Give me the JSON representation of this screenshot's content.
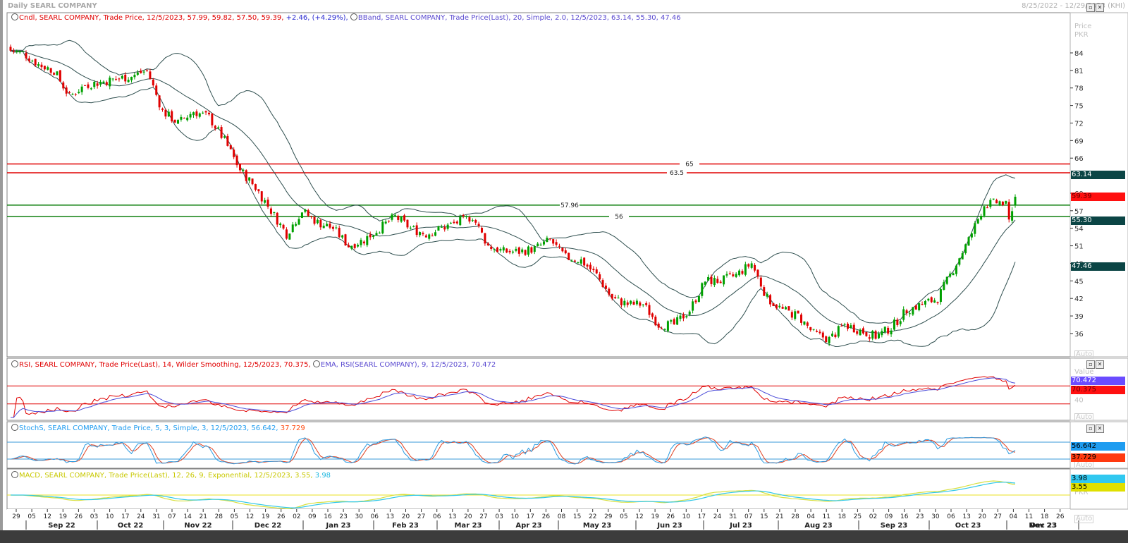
{
  "window": {
    "title": "Daily SEARL COMPANY",
    "date_range": "8/25/2022 - 12/29/2023 (KHI)"
  },
  "legends": {
    "candle": {
      "text": "Cndl, SEARL COMPANY, Trade Price,  12/5/2023, 57.99, 59.82, 57.50, 59.39, ",
      "change": "+2.46, (+4.29%), "
    },
    "bband": "BBand, SEARL COMPANY, Trade Price(Last),  20, Simple, 2.0, 12/5/2023, 63.14, 55.30, 47.46",
    "rsi": "RSI, SEARL COMPANY, Trade Price(Last),  14, Wilder Smoothing, 12/5/2023, 70.375, ",
    "ema": "EMA, RSI(SEARL COMPANY),  9,  12/5/2023, 70.472",
    "stoch": {
      "text": "StochS, SEARL COMPANY, Trade Price,  5, 3, Simple, 3, 12/5/2023, 56.642, ",
      "d": "37.729"
    },
    "macd": {
      "text": "MACD, SEARL COMPANY, Trade Price(Last),  12, 26, 9, Exponential, 12/5/2023, 3.55, ",
      "signal": "3.98"
    }
  },
  "axis_labels": {
    "price": "Price",
    "currency": "PKR",
    "value": "Value",
    "auto": "Auto"
  },
  "badges": {
    "bb_upper": {
      "text": "63.14",
      "value": 63.14,
      "color": "#0b4545"
    },
    "last": {
      "text": "59.39",
      "value": 59.39,
      "color": "#ff1010"
    },
    "bb_mid": {
      "text": "55.30",
      "value": 55.3,
      "color": "#0b4545"
    },
    "bb_lower": {
      "text": "47.46",
      "value": 47.46,
      "color": "#0b4545"
    },
    "ema": {
      "text": "70.472",
      "value": 70.472,
      "color": "#6a4cff"
    },
    "rsi": {
      "text": "70.375",
      "value": 70.375,
      "color": "#ff1010"
    },
    "stoch_k": {
      "text": "56.642",
      "value": 56.642,
      "color": "#1e9cf0"
    },
    "stoch_d": {
      "text": "37.729",
      "value": 37.729,
      "color": "#ff3a10"
    },
    "signal": {
      "text": "3.98",
      "value": 3.98,
      "color": "#30c8f0"
    },
    "macd": {
      "text": "3.55",
      "value": 3.55,
      "color": "#e0e000"
    }
  },
  "chart_data": {
    "type": "candlestick",
    "title": "Daily SEARL COMPANY",
    "ylabel": "Price PKR",
    "ylim": [
      33,
      87
    ],
    "yticks": [
      84,
      81,
      78,
      75,
      72,
      69,
      66,
      60,
      57,
      54,
      51,
      48,
      45,
      42,
      39,
      36
    ],
    "weekly_closes": [
      84,
      82,
      81,
      76.5,
      78.5,
      79,
      79.5,
      80,
      81,
      74,
      72,
      74,
      73,
      69,
      64,
      61,
      57,
      53,
      57,
      55,
      54,
      51,
      52,
      54,
      56,
      54,
      53,
      54,
      55,
      56,
      51,
      50,
      50,
      50.5,
      52,
      49,
      48.5,
      46,
      42,
      41,
      41,
      37.5,
      37.5,
      40,
      45,
      45,
      46,
      48,
      42,
      40,
      39,
      36,
      35,
      37.5,
      36.5,
      35.5,
      37,
      40,
      41,
      42,
      47,
      52,
      58,
      58.5,
      57
    ],
    "last_candle": {
      "date": "12/5/2023",
      "open": 57.99,
      "high": 59.82,
      "low": 57.5,
      "close": 59.39
    },
    "horizontal_lines": [
      {
        "value": 65,
        "label": "65",
        "color": "#e00000"
      },
      {
        "value": 63.5,
        "label": "63.5",
        "color": "#e00000"
      },
      {
        "value": 57.96,
        "label": "57.96",
        "color": "#108010"
      },
      {
        "value": 56,
        "label": "56",
        "color": "#108010"
      }
    ],
    "bollinger": {
      "period": 20,
      "stddev": 2.0
    },
    "rsi": {
      "period": 14,
      "ema": 9,
      "levels": [
        70,
        30
      ],
      "ticks": [
        "40"
      ]
    },
    "stoch": {
      "k": 5,
      "smooth": 3,
      "d": 3,
      "levels": [
        80,
        20
      ]
    },
    "macd": {
      "fast": 12,
      "slow": 26,
      "signal": 9
    },
    "x_ticks": [
      "29",
      "05",
      "12",
      "19",
      "26",
      "03",
      "10",
      "17",
      "24",
      "31",
      "07",
      "14",
      "21",
      "28",
      "05",
      "12",
      "19",
      "26",
      "02",
      "09",
      "16",
      "23",
      "30",
      "06",
      "13",
      "20",
      "27",
      "06",
      "13",
      "20",
      "27",
      "03",
      "10",
      "17",
      "26",
      "08",
      "15",
      "22",
      "29",
      "05",
      "12",
      "19",
      "26",
      "10",
      "17",
      "24",
      "31",
      "07",
      "15",
      "21",
      "28",
      "04",
      "11",
      "18",
      "25",
      "02",
      "09",
      "16",
      "23",
      "30",
      "06",
      "13",
      "20",
      "27",
      "04",
      "11",
      "18",
      "26"
    ],
    "months": [
      "Sep 22",
      "Oct 22",
      "Nov 22",
      "Dec 22",
      "Jan 23",
      "Feb 23",
      "Mar 23",
      "Apr 23",
      "May 23",
      "Jun 23",
      "Jul 23",
      "Aug 23",
      "Sep 23",
      "Oct 23",
      "Nov 23",
      "Dec 23"
    ]
  }
}
